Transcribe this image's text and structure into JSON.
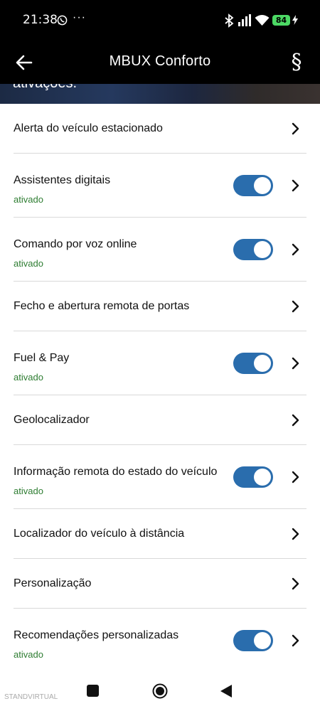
{
  "status_bar": {
    "time": "21:38",
    "dots": "···",
    "battery": "84",
    "icons": [
      "whatsapp-icon",
      "bluetooth-icon",
      "signal-icon",
      "wifi-icon",
      "battery-icon",
      "charging-icon"
    ]
  },
  "header": {
    "title": "MBUX Conforto",
    "back_icon": "arrow-left-icon",
    "logo": "§"
  },
  "hero": {
    "text": "ativações."
  },
  "items": [
    {
      "label": "Alerta do veículo estacionado",
      "status": "",
      "toggle": false
    },
    {
      "label": "Assistentes digitais",
      "status": "ativado",
      "toggle": true,
      "toggle_on": true
    },
    {
      "label": "Comando por voz online",
      "status": "ativado",
      "toggle": true,
      "toggle_on": true
    },
    {
      "label": "Fecho e abertura remota de portas",
      "status": "",
      "toggle": false
    },
    {
      "label": "Fuel & Pay",
      "status": "ativado",
      "toggle": true,
      "toggle_on": true
    },
    {
      "label": "Geolocalizador",
      "status": "",
      "toggle": false
    },
    {
      "label": "Informação remota do estado do veículo",
      "status": "ativado",
      "toggle": true,
      "toggle_on": true
    },
    {
      "label": "Localizador do veículo à distância",
      "status": "",
      "toggle": false
    },
    {
      "label": "Personalização",
      "status": "",
      "toggle": false
    },
    {
      "label": "Recomendações personalizadas",
      "status": "ativado",
      "toggle": true,
      "toggle_on": true
    }
  ],
  "colors": {
    "toggle_on": "#2a6dad",
    "status_text": "#2e7d32",
    "app_bar": "#000000"
  },
  "nav": {
    "icons": [
      "recents-icon",
      "home-icon",
      "back-triangle-icon"
    ]
  },
  "watermark": "STANDVIRTUAL"
}
